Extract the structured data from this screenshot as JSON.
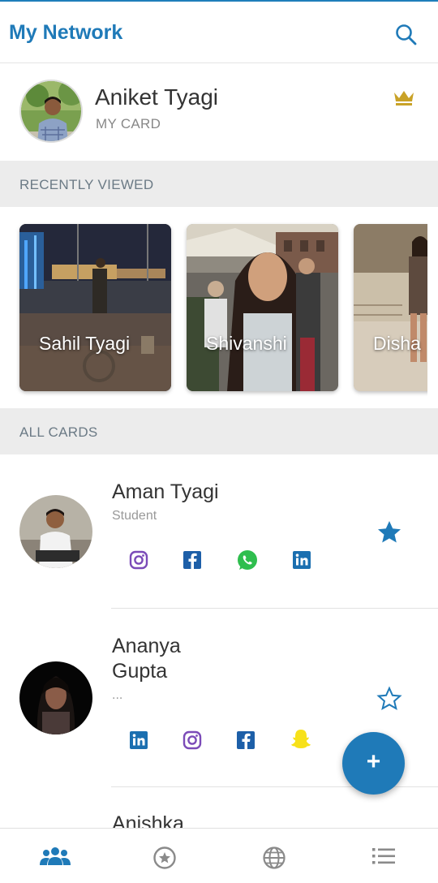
{
  "header": {
    "title": "My Network",
    "search_icon": "search-icon"
  },
  "my_card": {
    "name": "Aniket Tyagi",
    "subtitle": "MY CARD",
    "badge_icon": "crown-icon",
    "badge_color": "#c9a227"
  },
  "sections": {
    "recently_viewed": "RECENTLY VIEWED",
    "all_cards": "ALL CARDS"
  },
  "recently_viewed": [
    {
      "name": "Sahil Tyagi"
    },
    {
      "name": "Shivanshi"
    },
    {
      "name": "Disha"
    }
  ],
  "cards": [
    {
      "name": "Aman Tyagi",
      "role": "Student",
      "favorite": true,
      "socials": [
        "instagram-icon",
        "facebook-icon",
        "whatsapp-icon",
        "linkedin-icon"
      ]
    },
    {
      "name_line1": "Ananya",
      "name_line2": "Gupta",
      "role": "...",
      "favorite": false,
      "socials": [
        "linkedin-icon",
        "instagram-icon",
        "facebook-icon",
        "snapchat-icon"
      ]
    },
    {
      "name": "Anishka"
    }
  ],
  "fab": {
    "label": "+"
  },
  "bottom_nav": [
    "people-icon",
    "star-circle-icon",
    "globe-icon",
    "list-icon"
  ],
  "colors": {
    "accent": "#1f7ab8",
    "instagram": "#7b4bb8",
    "facebook": "#1d5fa8",
    "whatsapp": "#2fbe4e",
    "linkedin": "#1b6fb0",
    "snapchat": "#f7e11a"
  }
}
